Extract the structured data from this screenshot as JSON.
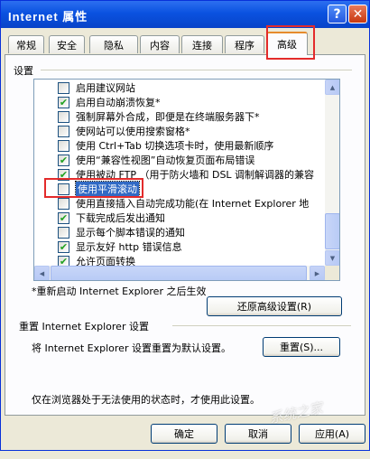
{
  "window": {
    "title": "Internet 属性"
  },
  "titlebar": {
    "help_symbol": "?",
    "close_symbol": "✕"
  },
  "tabs": [
    {
      "label": "常规"
    },
    {
      "label": "安全"
    },
    {
      "label": "隐私"
    },
    {
      "label": "内容"
    },
    {
      "label": "连接"
    },
    {
      "label": "程序"
    },
    {
      "label": "高级",
      "active": true
    }
  ],
  "settings": {
    "group_label": "设置",
    "items": [
      {
        "label": "启用建议网站",
        "checked": false
      },
      {
        "label": "启用自动崩溃恢复*",
        "checked": true
      },
      {
        "label": "强制屏幕外合成，即便是在终端服务器下*",
        "checked": false
      },
      {
        "label": "使网站可以使用搜索窗格*",
        "checked": false
      },
      {
        "label": "使用 Ctrl+Tab 切换选项卡时，使用最新顺序",
        "checked": false
      },
      {
        "label": "使用“兼容性视图”自动恢复页面布局错误",
        "checked": true
      },
      {
        "label": "使用被动 FTP （用于防火墙和 DSL 调制解调器的兼容",
        "checked": true
      },
      {
        "label": "使用平滑滚动",
        "checked": false,
        "selected": true
      },
      {
        "label": "使用直接插入自动完成功能(在 Internet Explorer 地",
        "checked": false
      },
      {
        "label": "下载完成后发出通知",
        "checked": true
      },
      {
        "label": "显示每个脚本错误的通知",
        "checked": false
      },
      {
        "label": "显示友好 http 错误信息",
        "checked": true
      },
      {
        "label": "允许页面转换",
        "checked": true
      }
    ],
    "check_mark": "✔"
  },
  "scrollbar": {
    "up": "▲",
    "down": "▼",
    "left": "◀",
    "right": "▶"
  },
  "restart_note": "*重新启动 Internet Explorer 之后生效",
  "restore_button": "还原高级设置(R)",
  "reset": {
    "title": "重置 Internet Explorer 设置",
    "description": "将 Internet Explorer 设置重置为默认设置。",
    "button": "重置(S)...",
    "note": "仅在浏览器处于无法使用的状态时，才使用此设置。"
  },
  "footer": {
    "ok": "确定",
    "cancel": "取消",
    "apply": "应用(A)"
  },
  "watermark": "系统之家"
}
